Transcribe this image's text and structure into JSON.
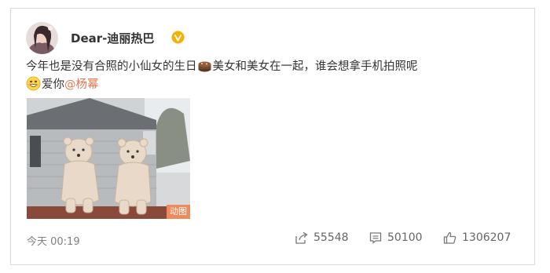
{
  "post": {
    "author": "Dear-迪丽热巴",
    "verified_icon": "verified-v-badge-icon",
    "text_part1": "今年也是没有合照的小仙女的生日",
    "emoji_cake": "cake-emoji-icon",
    "text_part2": "美女和美女在一起，谁会想拿手机拍照呢",
    "emoji_smile": "smile-emoji-icon",
    "text_part3": "爱你",
    "mention": "@杨幂",
    "gif_label": "动图",
    "timestamp": "今天 00:19"
  },
  "actions": {
    "forward_icon": "forward-icon",
    "forward_count": "55548",
    "comment_icon": "comment-icon",
    "comment_count": "50100",
    "like_icon": "thumbs-up-icon",
    "like_count": "1306207"
  },
  "colors": {
    "mention": "#eb7350",
    "verified": "#f6b000",
    "gif_label_bg": "#f08a5d"
  }
}
